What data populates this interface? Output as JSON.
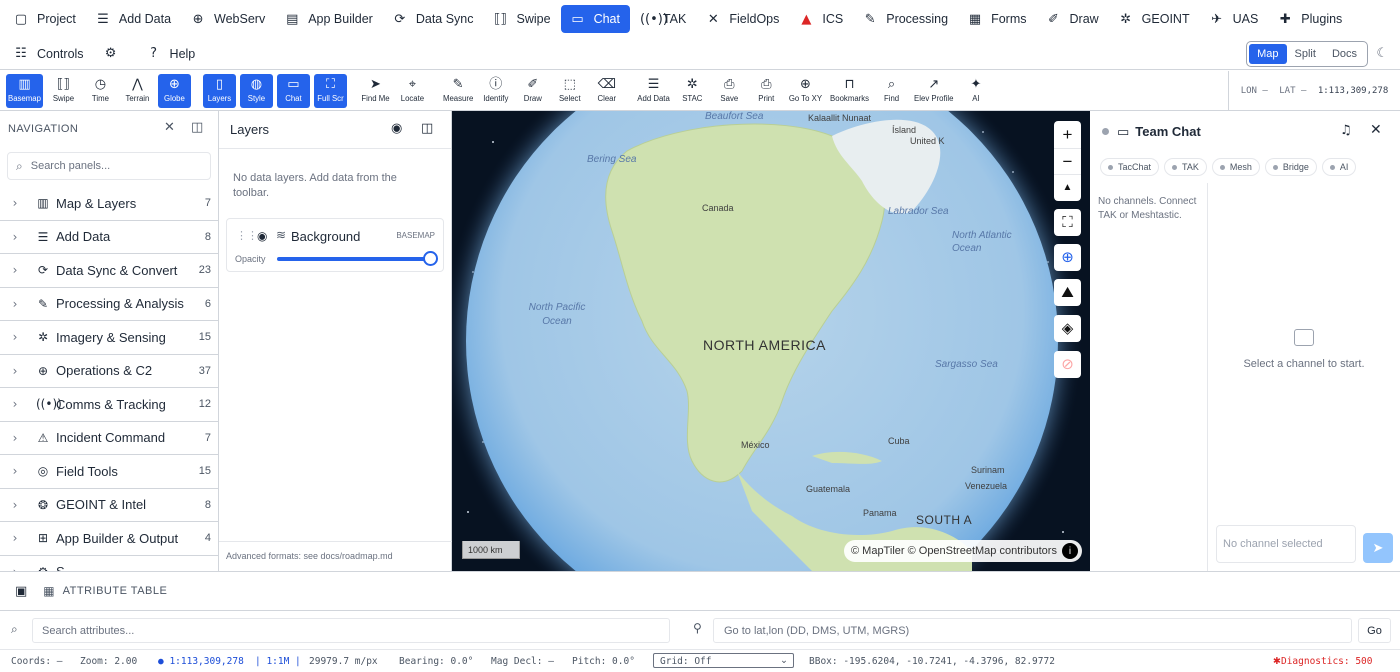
{
  "topnav": [
    {
      "label": "Project",
      "icon": "folder-icon",
      "glyph": "▢"
    },
    {
      "label": "Add Data",
      "icon": "database-icon",
      "glyph": "☰"
    },
    {
      "label": "WebServ",
      "icon": "globe-icon",
      "glyph": "⊕"
    },
    {
      "label": "App Builder",
      "icon": "document-icon",
      "glyph": "▤"
    },
    {
      "label": "Data Sync",
      "icon": "sync-icon",
      "glyph": "⟳"
    },
    {
      "label": "Swipe",
      "icon": "swipe-icon",
      "glyph": "⟦⟧"
    },
    {
      "label": "Chat",
      "icon": "chat-icon",
      "glyph": "▭",
      "active": true
    },
    {
      "label": "TAK",
      "icon": "radio-icon",
      "glyph": "((•))"
    },
    {
      "label": "FieldOps",
      "icon": "hammer-icon",
      "glyph": "✕"
    },
    {
      "label": "ICS",
      "icon": "ics-icon",
      "glyph": "▲"
    },
    {
      "label": "Processing",
      "icon": "wrench-icon",
      "glyph": "✎"
    },
    {
      "label": "Forms",
      "icon": "clipboard-icon",
      "glyph": "▦"
    },
    {
      "label": "Draw",
      "icon": "brush-icon",
      "glyph": "✐"
    },
    {
      "label": "GEOINT",
      "icon": "satellite-icon",
      "glyph": "✲"
    },
    {
      "label": "UAS",
      "icon": "drone-icon",
      "glyph": "✈"
    },
    {
      "label": "Plugins",
      "icon": "puzzle-icon",
      "glyph": "✚"
    }
  ],
  "secnav": [
    {
      "label": "Controls",
      "icon": "sliders-icon",
      "glyph": "☷"
    },
    {
      "label": "",
      "icon": "gear-icon",
      "glyph": "⚙"
    },
    {
      "label": "Help",
      "icon": "help-icon",
      "glyph": "?"
    }
  ],
  "viewswitch": [
    "Map",
    "Split",
    "Docs"
  ],
  "toolbar": [
    {
      "label": "Basemap",
      "icon": "map-icon",
      "glyph": "▥",
      "on": true
    },
    {
      "label": "Swipe",
      "icon": "swipe-icon",
      "glyph": "⟦⟧"
    },
    {
      "label": "Time",
      "icon": "clock-icon",
      "glyph": "◷"
    },
    {
      "label": "Terrain",
      "icon": "mountain-icon",
      "glyph": "⋀"
    },
    {
      "label": "Globe",
      "icon": "globe-icon",
      "glyph": "⊕",
      "on": true
    },
    {
      "sep": true
    },
    {
      "label": "Layers",
      "icon": "layers-icon",
      "glyph": "▯",
      "on": true
    },
    {
      "label": "Style",
      "icon": "palette-icon",
      "glyph": "◍",
      "on": true
    },
    {
      "label": "Chat",
      "icon": "chat-icon",
      "glyph": "▭",
      "on": true
    },
    {
      "label": "Full Scr",
      "icon": "fullscreen-icon",
      "glyph": "⛶",
      "on": true
    },
    {
      "sep": true
    },
    {
      "label": "Find Me",
      "icon": "navigation-icon",
      "glyph": "➤"
    },
    {
      "label": "Locate",
      "icon": "crosshair-icon",
      "glyph": "⌖"
    },
    {
      "sep": true
    },
    {
      "label": "Measure",
      "icon": "ruler-icon",
      "glyph": "✎"
    },
    {
      "label": "Identify",
      "icon": "info-icon",
      "glyph": "ⓘ"
    },
    {
      "label": "Draw",
      "icon": "pen-icon",
      "glyph": "✐"
    },
    {
      "label": "Select",
      "icon": "select-icon",
      "glyph": "⬚"
    },
    {
      "label": "Clear",
      "icon": "eraser-icon",
      "glyph": "⌫"
    },
    {
      "sep": true
    },
    {
      "label": "Add Data",
      "icon": "database-icon",
      "glyph": "☰"
    },
    {
      "label": "STAC",
      "icon": "satellite-icon",
      "glyph": "✲"
    },
    {
      "label": "Save",
      "icon": "save-icon",
      "glyph": "⎙"
    },
    {
      "label": "Print",
      "icon": "printer-icon",
      "glyph": "⎙"
    },
    {
      "label": "Go To XY",
      "icon": "target-icon",
      "glyph": "⊕"
    },
    {
      "label": "Bookmarks",
      "icon": "bookmark-icon",
      "glyph": "⊓"
    },
    {
      "label": "Find",
      "icon": "search-icon",
      "glyph": "⌕"
    },
    {
      "label": "Elev Profile",
      "icon": "chart-line-icon",
      "glyph": "↗"
    },
    {
      "label": "AI",
      "icon": "sparkles-icon",
      "glyph": "✦"
    }
  ],
  "coords_top": {
    "lon": "LON —",
    "lat": "LAT —",
    "scale": "1:113,309,278"
  },
  "navigation": {
    "title": "NAVIGATION",
    "search_placeholder": "Search panels...",
    "items": [
      {
        "label": "Map & Layers",
        "count": "7",
        "icon": "map-icon",
        "glyph": "▥"
      },
      {
        "label": "Add Data",
        "count": "8",
        "icon": "database-icon",
        "glyph": "☰"
      },
      {
        "label": "Data Sync & Convert",
        "count": "23",
        "icon": "sync-icon",
        "glyph": "⟳"
      },
      {
        "label": "Processing & Analysis",
        "count": "6",
        "icon": "wrench-icon",
        "glyph": "✎"
      },
      {
        "label": "Imagery & Sensing",
        "count": "15",
        "icon": "satellite-icon",
        "glyph": "✲"
      },
      {
        "label": "Operations & C2",
        "count": "37",
        "icon": "crosshair-icon",
        "glyph": "⊕"
      },
      {
        "label": "Comms & Tracking",
        "count": "12",
        "icon": "radio-icon",
        "glyph": "((•))"
      },
      {
        "label": "Incident Command",
        "count": "7",
        "icon": "warning-icon",
        "glyph": "⚠"
      },
      {
        "label": "Field Tools",
        "count": "15",
        "icon": "compass-icon",
        "glyph": "◎"
      },
      {
        "label": "GEOINT & Intel",
        "count": "8",
        "icon": "brain-icon",
        "glyph": "❂"
      },
      {
        "label": "App Builder & Output",
        "count": "4",
        "icon": "grid-icon",
        "glyph": "⊞"
      },
      {
        "label": "S",
        "count": "",
        "icon": "settings-icon",
        "glyph": "⚙"
      }
    ]
  },
  "layers": {
    "title": "Layers",
    "empty_msg": "No data layers. Add data from the toolbar.",
    "background": {
      "name": "Background",
      "tag": "BASEMAP",
      "opacity_label": "Opacity",
      "opacity": 1.0
    },
    "footer": "Advanced formats: see docs/roadmap.md"
  },
  "map": {
    "labels": {
      "beaufort": "Beaufort Sea",
      "kalaallit": "Kalaallit Nunaat",
      "island": "Ísland",
      "uk": "United K",
      "bering": "Bering Sea",
      "canada": "Canada",
      "labrador": "Labrador Sea",
      "natlantic": "North Atlantic Ocean",
      "npacific": "North Pacific Ocean",
      "namerica": "NORTH AMERICA",
      "sargasso": "Sargasso Sea",
      "mexico": "México",
      "cuba": "Cuba",
      "guatemala": "Guatemala",
      "venezuela": "Venezuela",
      "surinam": "Surinam",
      "panama": "Panama",
      "samerica": "SOUTH A"
    },
    "attribution": "© MapTiler © OpenStreetMap contributors",
    "scale_label": "1000 km",
    "zoom_in": "+",
    "zoom_out": "−",
    "compass": "▲"
  },
  "chat": {
    "title": "Team Chat",
    "chips": [
      "TacChat",
      "TAK",
      "Mesh",
      "Bridge",
      "AI"
    ],
    "no_channels": "No channels. Connect TAK or Meshtastic.",
    "select_prompt": "Select a channel to start.",
    "input_placeholder": "No channel selected"
  },
  "attribute_table": {
    "title": "ATTRIBUTE TABLE"
  },
  "search_attrs_placeholder": "Search attributes...",
  "goto_placeholder": "Go to lat,lon (DD, DMS, UTM, MGRS)",
  "goto_button": "Go",
  "status": {
    "coords": "Coords: —",
    "zoom": "Zoom: 2.00",
    "scale": "● 1:113,309,278",
    "ratio": "| 1:1M |",
    "mpp": "29979.7 m/px",
    "bearing": "Bearing: 0.0°",
    "magdecl": "Mag Decl: —",
    "pitch": "Pitch: 0.0°",
    "grid": "Grid: Off",
    "bbox": "BBox: -195.6204, -10.7241, -4.3796, 82.9772",
    "diagnostics": "Diagnostics: 500"
  },
  "colors": {
    "accent": "#2563eb",
    "danger": "#dc2626"
  }
}
